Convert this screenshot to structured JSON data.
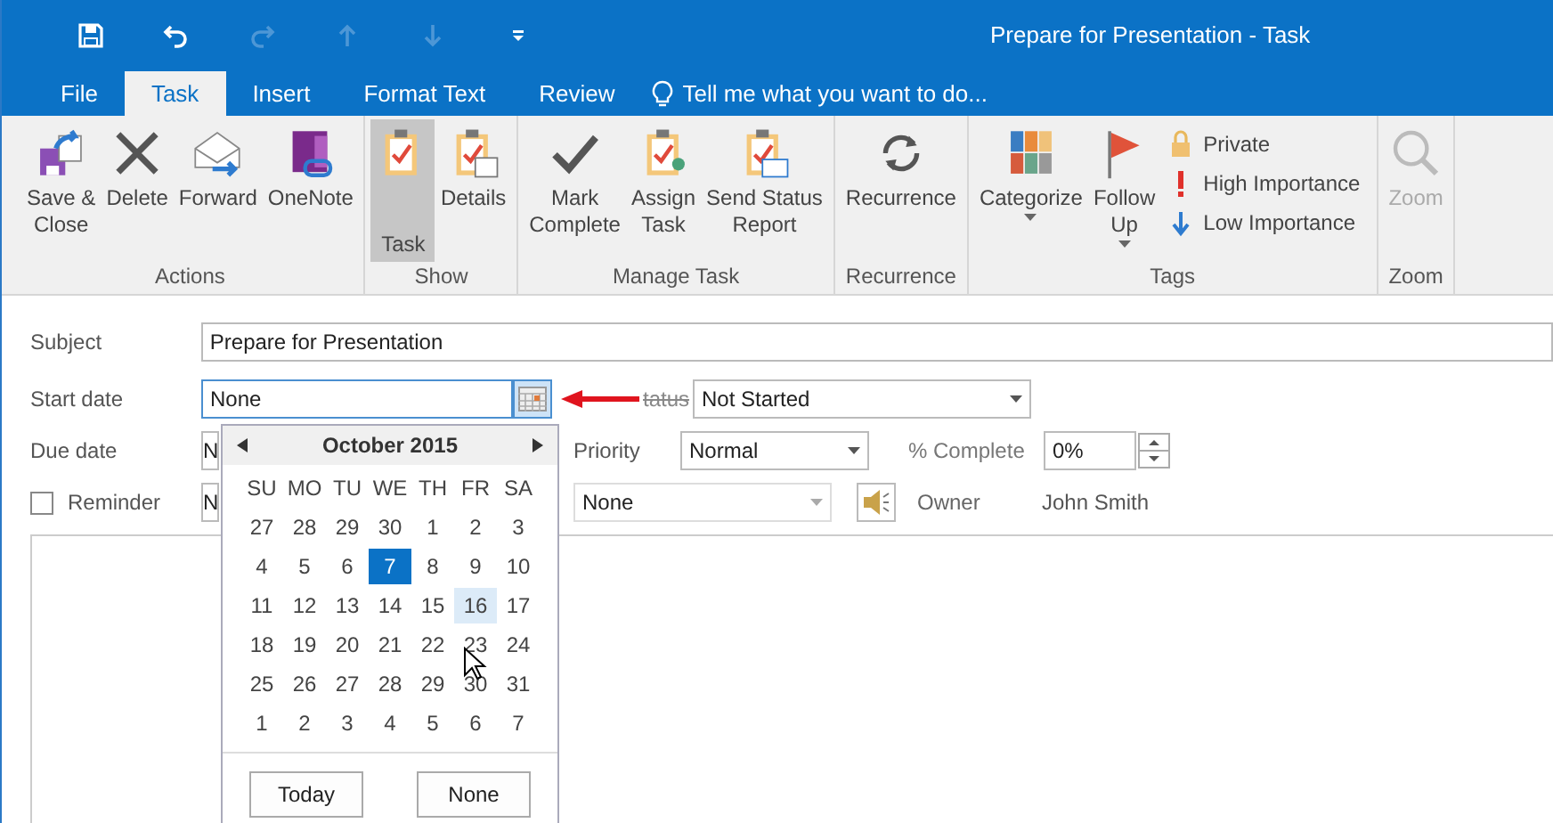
{
  "quick_access": [
    {
      "kind": "save",
      "disabled": false
    },
    {
      "kind": "undo",
      "disabled": false
    },
    {
      "kind": "redo",
      "disabled": true
    },
    {
      "kind": "up",
      "disabled": true
    },
    {
      "kind": "down",
      "disabled": true
    },
    {
      "kind": "customize",
      "disabled": false
    }
  ],
  "window": {
    "title": "Prepare for Presentation - Task"
  },
  "tabs": [
    {
      "label": "File",
      "selected": false
    },
    {
      "label": "Task",
      "selected": true
    },
    {
      "label": "Insert",
      "selected": false
    },
    {
      "label": "Format Text",
      "selected": false
    },
    {
      "label": "Review",
      "selected": false
    }
  ],
  "tell_me": {
    "placeholder": "Tell me what you want to do..."
  },
  "ribbon_groups": [
    {
      "label": "Actions",
      "buttons": [
        {
          "kind": "save-close",
          "label": "Save &\nClose",
          "selected": false,
          "disabled": false,
          "dropdown": false
        },
        {
          "kind": "delete",
          "label": "Delete",
          "selected": false,
          "disabled": false,
          "dropdown": false
        },
        {
          "kind": "forward",
          "label": "Forward",
          "selected": false,
          "disabled": false,
          "dropdown": false
        },
        {
          "kind": "onenote",
          "label": "OneNote",
          "selected": false,
          "disabled": false,
          "dropdown": false
        }
      ]
    },
    {
      "label": "Show",
      "buttons": [
        {
          "kind": "task",
          "label": "Task",
          "selected": true,
          "disabled": false,
          "dropdown": false
        },
        {
          "kind": "details",
          "label": "Details",
          "selected": false,
          "disabled": false,
          "dropdown": false
        }
      ]
    },
    {
      "label": "Manage Task",
      "buttons": [
        {
          "kind": "check",
          "label": "Mark\nComplete",
          "selected": false,
          "disabled": false,
          "dropdown": false
        },
        {
          "kind": "assign",
          "label": "Assign\nTask",
          "selected": false,
          "disabled": false,
          "dropdown": false
        },
        {
          "kind": "report",
          "label": "Send Status\nReport",
          "selected": false,
          "disabled": false,
          "dropdown": false
        }
      ]
    },
    {
      "label": "Recurrence",
      "buttons": [
        {
          "kind": "recurrence",
          "label": "Recurrence",
          "selected": false,
          "disabled": false,
          "dropdown": false
        }
      ]
    },
    {
      "label": "Tags",
      "buttons": [
        {
          "kind": "categorize",
          "label": "Categorize",
          "selected": false,
          "disabled": false,
          "dropdown": true
        },
        {
          "kind": "flag",
          "label": "Follow\nUp",
          "selected": false,
          "disabled": false,
          "dropdown": true
        }
      ],
      "small_buttons": [
        {
          "kind": "lock",
          "label": "Private"
        },
        {
          "kind": "high",
          "label": "High Importance"
        },
        {
          "kind": "low",
          "label": "Low Importance"
        }
      ]
    },
    {
      "label": "Zoom",
      "buttons": [
        {
          "kind": "zoom",
          "label": "Zoom",
          "selected": false,
          "disabled": true,
          "dropdown": false
        }
      ]
    }
  ],
  "form": {
    "subject": {
      "label": "Subject",
      "value": "Prepare for Presentation"
    },
    "start_date": {
      "label": "Start date",
      "value": "None"
    },
    "status": {
      "label": "tatus",
      "value": "Not Started"
    },
    "due_date": {
      "label": "Due date",
      "value": "N"
    },
    "priority": {
      "label": "Priority",
      "value": "Normal"
    },
    "percent_complete": {
      "label": "% Complete",
      "value": "0%"
    },
    "reminder": {
      "label": "Reminder",
      "checked": false,
      "date": "N",
      "time": "None"
    },
    "owner": {
      "label": "Owner",
      "value": "John Smith"
    }
  },
  "calendar": {
    "month": "October 2015",
    "weekdays": [
      "SU",
      "MO",
      "TU",
      "WE",
      "TH",
      "FR",
      "SA"
    ],
    "weeks": [
      [
        {
          "day": "27",
          "selected": false,
          "hovered": false
        },
        {
          "day": "28",
          "selected": false,
          "hovered": false
        },
        {
          "day": "29",
          "selected": false,
          "hovered": false
        },
        {
          "day": "30",
          "selected": false,
          "hovered": false
        },
        {
          "day": "1",
          "selected": false,
          "hovered": false
        },
        {
          "day": "2",
          "selected": false,
          "hovered": false
        },
        {
          "day": "3",
          "selected": false,
          "hovered": false
        }
      ],
      [
        {
          "day": "4",
          "selected": false,
          "hovered": false
        },
        {
          "day": "5",
          "selected": false,
          "hovered": false
        },
        {
          "day": "6",
          "selected": false,
          "hovered": false
        },
        {
          "day": "7",
          "selected": true,
          "hovered": false
        },
        {
          "day": "8",
          "selected": false,
          "hovered": false
        },
        {
          "day": "9",
          "selected": false,
          "hovered": false
        },
        {
          "day": "10",
          "selected": false,
          "hovered": false
        }
      ],
      [
        {
          "day": "11",
          "selected": false,
          "hovered": false
        },
        {
          "day": "12",
          "selected": false,
          "hovered": false
        },
        {
          "day": "13",
          "selected": false,
          "hovered": false
        },
        {
          "day": "14",
          "selected": false,
          "hovered": false
        },
        {
          "day": "15",
          "selected": false,
          "hovered": false
        },
        {
          "day": "16",
          "selected": false,
          "hovered": true
        },
        {
          "day": "17",
          "selected": false,
          "hovered": false
        }
      ],
      [
        {
          "day": "18",
          "selected": false,
          "hovered": false
        },
        {
          "day": "19",
          "selected": false,
          "hovered": false
        },
        {
          "day": "20",
          "selected": false,
          "hovered": false
        },
        {
          "day": "21",
          "selected": false,
          "hovered": false
        },
        {
          "day": "22",
          "selected": false,
          "hovered": false
        },
        {
          "day": "23",
          "selected": false,
          "hovered": false
        },
        {
          "day": "24",
          "selected": false,
          "hovered": false
        }
      ],
      [
        {
          "day": "25",
          "selected": false,
          "hovered": false
        },
        {
          "day": "26",
          "selected": false,
          "hovered": false
        },
        {
          "day": "27",
          "selected": false,
          "hovered": false
        },
        {
          "day": "28",
          "selected": false,
          "hovered": false
        },
        {
          "day": "29",
          "selected": false,
          "hovered": false
        },
        {
          "day": "30",
          "selected": false,
          "hovered": false
        },
        {
          "day": "31",
          "selected": false,
          "hovered": false
        }
      ],
      [
        {
          "day": "1",
          "selected": false,
          "hovered": false
        },
        {
          "day": "2",
          "selected": false,
          "hovered": false
        },
        {
          "day": "3",
          "selected": false,
          "hovered": false
        },
        {
          "day": "4",
          "selected": false,
          "hovered": false
        },
        {
          "day": "5",
          "selected": false,
          "hovered": false
        },
        {
          "day": "6",
          "selected": false,
          "hovered": false
        },
        {
          "day": "7",
          "selected": false,
          "hovered": false
        }
      ]
    ],
    "buttons": [
      "Today",
      "None"
    ]
  }
}
